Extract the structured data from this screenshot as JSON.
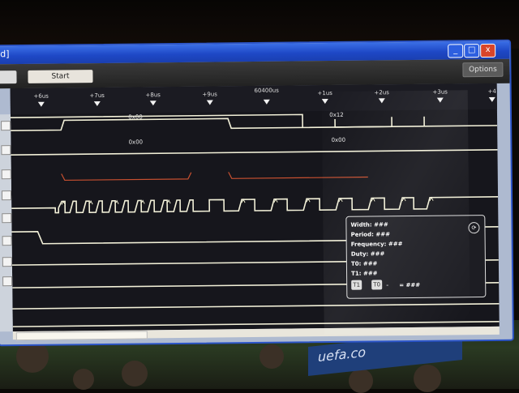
{
  "window": {
    "title": "d]",
    "minimize_label": "_",
    "maximize_label": "□",
    "close_label": "x"
  },
  "toolbar": {
    "left_label": "",
    "start_label": "Start",
    "options_label": "Options"
  },
  "ruler": {
    "ticks": [
      "+6us",
      "+7us",
      "+8us",
      "+9us",
      "60400us",
      "+1us",
      "+2us",
      "+3us",
      "+4"
    ]
  },
  "bus": {
    "row1": [
      "0x00",
      "0x12"
    ],
    "row2": [
      "0x00",
      "0x00"
    ]
  },
  "measurements": {
    "width": "Width: ###",
    "period": "Period: ###",
    "frequency": "Frequency: ###",
    "duty": "Duty: ###",
    "t0": "T0: ###",
    "t1": "T1: ###",
    "chip_a": "T1",
    "chip_b": "T0",
    "dash": "-",
    "equals": "= ###",
    "close_icon": "⟳"
  },
  "background": {
    "banner_text": "uefa.co"
  },
  "colors": {
    "title_bar": "#1e48c6",
    "close_button": "#d8452a",
    "waveform": "#f2f0d8",
    "bus_outline": "#c85030"
  }
}
